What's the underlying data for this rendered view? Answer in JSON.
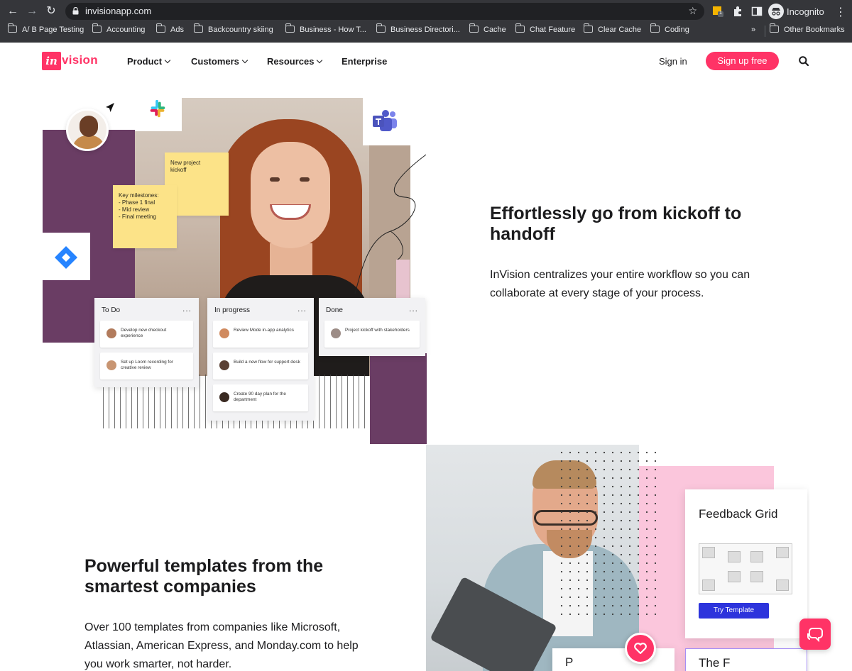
{
  "browser": {
    "url": "invisionapp.com",
    "profile_label": "Incognito",
    "bookmarks": [
      "A/ B Page Testing",
      "Accounting",
      "Ads",
      "Backcountry skiing",
      "Business - How T...",
      "Business Directori...",
      "Cache",
      "Chat Feature",
      "Clear Cache",
      "Coding"
    ],
    "more_label": "»",
    "other_bookmarks": "Other Bookmarks",
    "extension_badge": "1"
  },
  "header": {
    "logo_in": "in",
    "logo_vision": "vision",
    "nav": [
      {
        "label": "Product",
        "dropdown": true
      },
      {
        "label": "Customers",
        "dropdown": true
      },
      {
        "label": "Resources",
        "dropdown": true
      },
      {
        "label": "Enterprise",
        "dropdown": false
      }
    ],
    "sign_in": "Sign in",
    "sign_up": "Sign up free",
    "accent": "#ff3366"
  },
  "hero": {
    "title": "Effortlessly go from kickoff to handoff",
    "body": "InVision centralizes your entire workflow so you can collaborate at every stage of your process.",
    "sticky_notes": [
      "New project\nkickoff",
      "Key milestones:\n- Phase 1 final\n- Mid review\n- Final meeting"
    ],
    "kanban": {
      "todo": {
        "title": "To Do",
        "cards": [
          "Develop new checkout experience",
          "Set up Loom recording for creative review"
        ]
      },
      "in_progress": {
        "title": "In progress",
        "cards": [
          "Review Mode in-app analytics",
          "Build a new flow for support desk",
          "Create 90 day plan for the department"
        ]
      },
      "done": {
        "title": "Done",
        "cards": [
          "Project kickoff with stakeholders"
        ]
      },
      "menu_label": "..."
    }
  },
  "templates": {
    "title": "Powerful templates from the smartest companies",
    "body": "Over 100 templates from companies like Microsoft, Atlassian, American Express, and Monday.com to help you work smarter, not harder.",
    "card_title": "Feedback Grid",
    "card_button": "Try Template",
    "card2_text": "P",
    "card3_text": "The F",
    "button_color": "#2d34dc"
  }
}
